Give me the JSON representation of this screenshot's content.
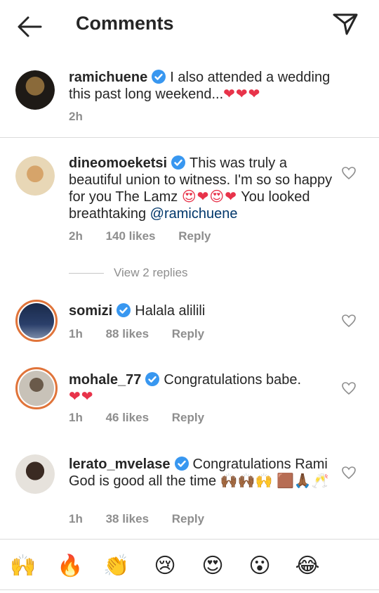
{
  "header": {
    "title": "Comments",
    "back_icon": "arrow-left-icon",
    "share_icon": "paper-plane-icon"
  },
  "caption": {
    "username": "ramichuene",
    "text": "I also attended a wedding this past  long weekend...",
    "emojis": "❤❤❤",
    "time": "2h"
  },
  "comments": [
    {
      "username": "dineomoeketsi",
      "text_1": "This was truly a beautiful union to witness. I'm so so happy for you The Lamz ",
      "emojis": "😍❤😍❤",
      "text_2": " You looked breathtaking ",
      "mention": "@ramichuene",
      "time": "2h",
      "likes": "140 likes",
      "reply": "Reply"
    },
    {
      "username": "somizi",
      "text_1": "Halala alilili",
      "time": "1h",
      "likes": "88 likes",
      "reply": "Reply"
    },
    {
      "username": "mohale_77",
      "text_1": "Congratulations babe.",
      "emojis": "❤❤",
      "time": "1h",
      "likes": "46 likes",
      "reply": "Reply"
    },
    {
      "username": "lerato_mvelase",
      "text_1": "Congratulations Rami God is good all the time ",
      "emojis": "🙌🏾🙌🏾🙌 🟫🙏🏾🥂",
      "time": "1h",
      "likes": "38 likes",
      "reply": "Reply"
    }
  ],
  "view_replies": "View 2 replies",
  "emoji_bar": [
    "🙌",
    "🔥",
    "👏",
    "😢",
    "😍",
    "😮",
    "😂"
  ],
  "colors": {
    "verified": "#3897f0",
    "mention": "#00376b",
    "meta": "#8e8e8e",
    "heart": "#e8334a",
    "story_ring": "#e0743a"
  }
}
